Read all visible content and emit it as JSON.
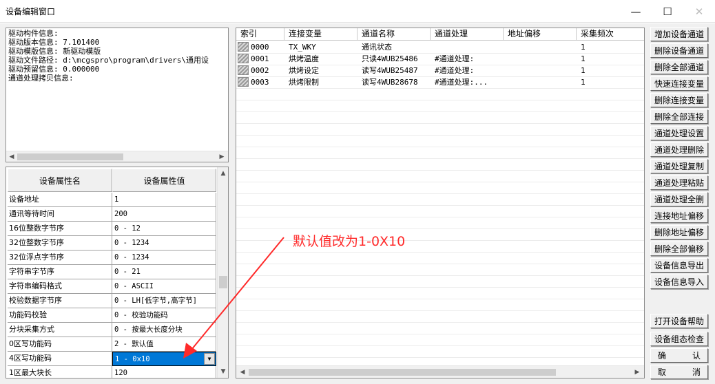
{
  "window": {
    "title": "设备编辑窗口",
    "minimize_symbol": "—",
    "maximize_symbol": "☐",
    "close_symbol": "✕"
  },
  "info_panel": {
    "lines": [
      "驱动构件信息:",
      "驱动版本信息: 7.101400",
      "驱动模版信息: 新驱动模版",
      "驱动文件路径: d:\\mcgspro\\program\\drivers\\通用设",
      "驱动预留信息: 0.000000",
      "通道处理拷贝信息:"
    ]
  },
  "property_table": {
    "headers": [
      "设备属性名",
      "设备属性值"
    ],
    "rows": [
      {
        "name": "设备地址",
        "value": "1"
      },
      {
        "name": "通讯等待时间",
        "value": "200"
      },
      {
        "name": "16位整数字节序",
        "value": "0 - 12"
      },
      {
        "name": "32位整数字节序",
        "value": "0 - 1234"
      },
      {
        "name": "32位浮点字节序",
        "value": "0 - 1234"
      },
      {
        "name": "字符串字节序",
        "value": "0 - 21"
      },
      {
        "name": "字符串编码格式",
        "value": "0 - ASCII"
      },
      {
        "name": "校验数据字节序",
        "value": "0 - LH[低字节,高字节]"
      },
      {
        "name": "功能码校验",
        "value": "0 - 校验功能码"
      },
      {
        "name": "分块采集方式",
        "value": "0 - 按最大长度分块"
      },
      {
        "name": "0区写功能码",
        "value": "2 - 默认值"
      },
      {
        "name": "4区写功能码",
        "value": "1 - 0x10"
      },
      {
        "name": "1区最大块长",
        "value": "120"
      }
    ],
    "selected_index": 11
  },
  "channel_list": {
    "headers": [
      "索引",
      "连接变量",
      "通道名称",
      "通道处理",
      "地址偏移",
      "采集频次"
    ],
    "rows": [
      [
        "0000",
        "TX_WKY",
        "通讯状态",
        "",
        "",
        "1"
      ],
      [
        "0001",
        "烘烤温度",
        "只读4WUB25486",
        "#通道处理:",
        "",
        "1"
      ],
      [
        "0002",
        "烘烤设定",
        "读写4WUB25487",
        "#通道处理:",
        "",
        "1"
      ],
      [
        "0003",
        "烘烤限制",
        "读写4WUB28678",
        "#通道处理:...",
        "",
        "1"
      ]
    ]
  },
  "buttons": [
    "增加设备通道",
    "删除设备通道",
    "删除全部通道",
    "快速连接变量",
    "删除连接变量",
    "删除全部连接",
    "通道处理设置",
    "通道处理删除",
    "通道处理复制",
    "通道处理粘贴",
    "通道处理全删",
    "连接地址偏移",
    "删除地址偏移",
    "删除全部偏移",
    "设备信息导出",
    "设备信息导入"
  ],
  "bottom_buttons": {
    "help": "打开设备帮助",
    "check": "设备组态检查",
    "ok": [
      "确",
      "认"
    ],
    "cancel": [
      "取",
      "消"
    ]
  },
  "annotation": {
    "text": "默认值改为1-0X10",
    "color": "#ff2a2a"
  }
}
